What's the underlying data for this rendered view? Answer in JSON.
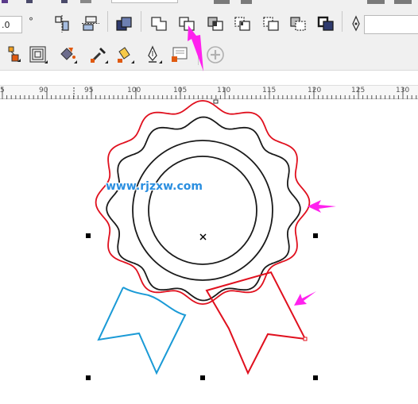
{
  "property_bar": {
    "outline_width_value": ".0",
    "degree_symbol": "°",
    "style_dropdown_value": ""
  },
  "shaping_buttons": [
    "weld-icon",
    "trim-icon",
    "intersect-icon",
    "simplify-icon",
    "front-minus-back-icon",
    "back-minus-front-icon",
    "create-boundary-icon"
  ],
  "ruler": {
    "labels": [
      "5",
      "90",
      "95",
      "100",
      "105",
      "110",
      "115",
      "120",
      "125",
      "130"
    ]
  },
  "canvas": {
    "watermark": "www.rjzxw.com"
  },
  "colors": {
    "outline_red": "#e0101e",
    "ribbon_blue": "#1a9ad6",
    "annotation_arrow": "#ff22ee",
    "dark_outline": "#1a1a1a"
  }
}
